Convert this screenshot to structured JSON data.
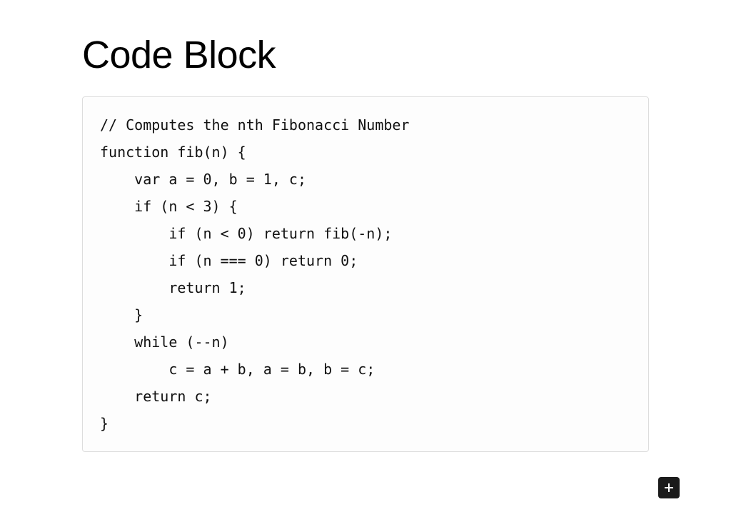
{
  "heading": "Code Block",
  "code": "// Computes the nth Fibonacci Number\nfunction fib(n) {\n    var a = 0, b = 1, c;\n    if (n < 3) {\n        if (n < 0) return fib(-n);\n        if (n === 0) return 0;\n        return 1;\n    }\n    while (--n)\n        c = a + b, a = b, b = c;\n    return c;\n}"
}
